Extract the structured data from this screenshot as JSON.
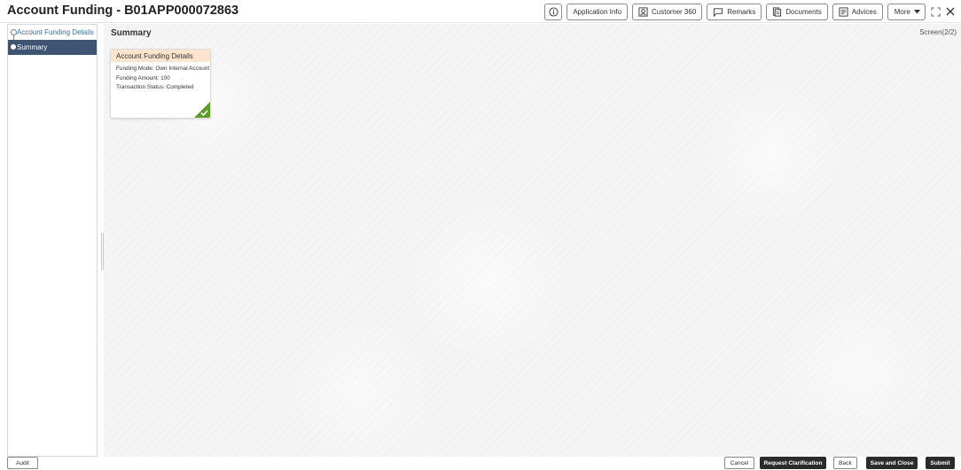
{
  "header": {
    "title": "Account Funding - B01APP000072863",
    "actions": {
      "application_info": "Application Info",
      "customer_360": "Customer 360",
      "remarks": "Remarks",
      "documents": "Documents",
      "advices": "Advices",
      "more": "More"
    }
  },
  "sidebar": {
    "items": [
      {
        "label": "Account Funding Details",
        "state": "visited"
      },
      {
        "label": "Summary",
        "state": "active"
      }
    ]
  },
  "main": {
    "section_title": "Summary",
    "screen_indicator": "Screen(2/2)",
    "card": {
      "title": "Account Funding Details",
      "lines": [
        "Funding Mode: Own Internal Account",
        "Funding Amount: 100",
        "Transaction Status: Completed"
      ],
      "status_icon": "check-icon"
    }
  },
  "footer": {
    "audit": "Audit",
    "cancel": "Cancel",
    "request_clarification": "Request Clarification",
    "back": "Back",
    "save_and_close": "Save and Close",
    "submit": "Submit"
  },
  "colors": {
    "sidebar_active": "#3f5372",
    "card_header": "#fde4cc",
    "card_check": "#5f9a2b",
    "primary_button": "#2b2b2b"
  }
}
